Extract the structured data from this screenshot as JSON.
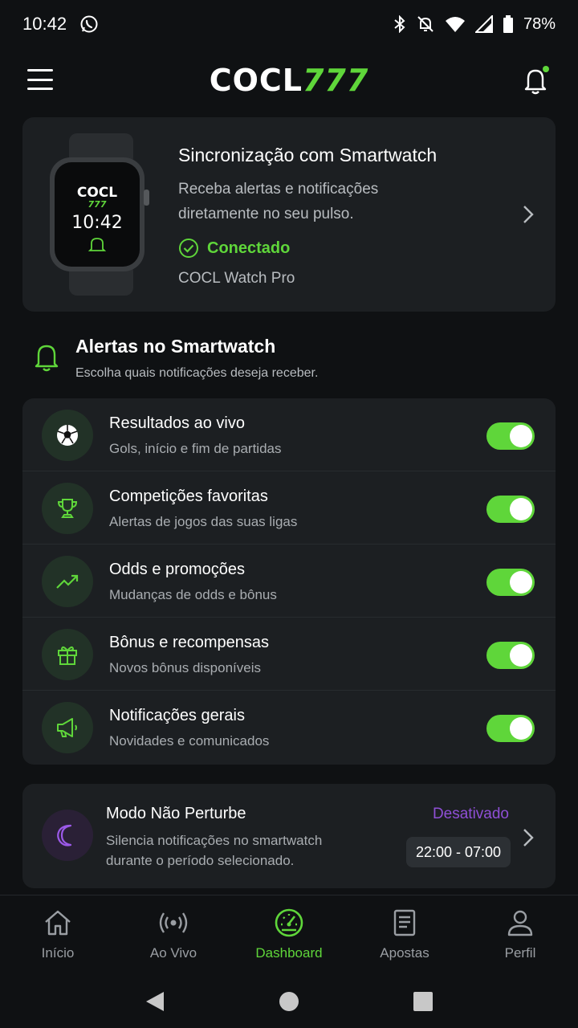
{
  "status_bar": {
    "time": "10:42",
    "battery": "78%"
  },
  "header": {
    "logo_white": "COCL",
    "logo_green": "777"
  },
  "watch_card": {
    "watch_brand": "COCL",
    "watch_brand_num": "777",
    "watch_time": "10:42",
    "title": "Sincronização com Smartwatch",
    "description": "Receba alertas e notificações diretamente no seu pulso.",
    "status": "Conectado",
    "device": "COCL Watch Pro"
  },
  "alerts_section": {
    "title": "Alertas no Smartwatch",
    "subtitle": "Escolha quais notificações deseja receber.",
    "items": [
      {
        "title": "Resultados ao vivo",
        "subtitle": "Gols, início e fim de partidas",
        "icon": "soccer-ball-icon",
        "enabled": true
      },
      {
        "title": "Competições favoritas",
        "subtitle": "Alertas de jogos das suas ligas",
        "icon": "trophy-icon",
        "enabled": true
      },
      {
        "title": "Odds e promoções",
        "subtitle": "Mudanças de odds e bônus",
        "icon": "trending-up-icon",
        "enabled": true
      },
      {
        "title": "Bônus e recompensas",
        "subtitle": "Novos bônus disponíveis",
        "icon": "gift-icon",
        "enabled": true
      },
      {
        "title": "Notificações gerais",
        "subtitle": "Novidades e comunicados",
        "icon": "megaphone-icon",
        "enabled": true
      }
    ]
  },
  "dnd": {
    "title": "Modo Não Perturbe",
    "description": "Silencia notificações no smartwatch durante o período selecionado.",
    "status": "Desativado",
    "time_range": "22:00 - 07:00"
  },
  "bottom_nav": {
    "items": [
      {
        "label": "Início",
        "icon": "home-icon"
      },
      {
        "label": "Ao Vivo",
        "icon": "broadcast-icon"
      },
      {
        "label": "Dashboard",
        "icon": "dashboard-gauge-icon",
        "active": true
      },
      {
        "label": "Apostas",
        "icon": "document-icon"
      },
      {
        "label": "Perfil",
        "icon": "user-icon"
      }
    ]
  },
  "colors": {
    "accent": "#5fd63a",
    "purple": "#8f4fd6",
    "card": "#1c1f22",
    "background": "#0f1113"
  }
}
